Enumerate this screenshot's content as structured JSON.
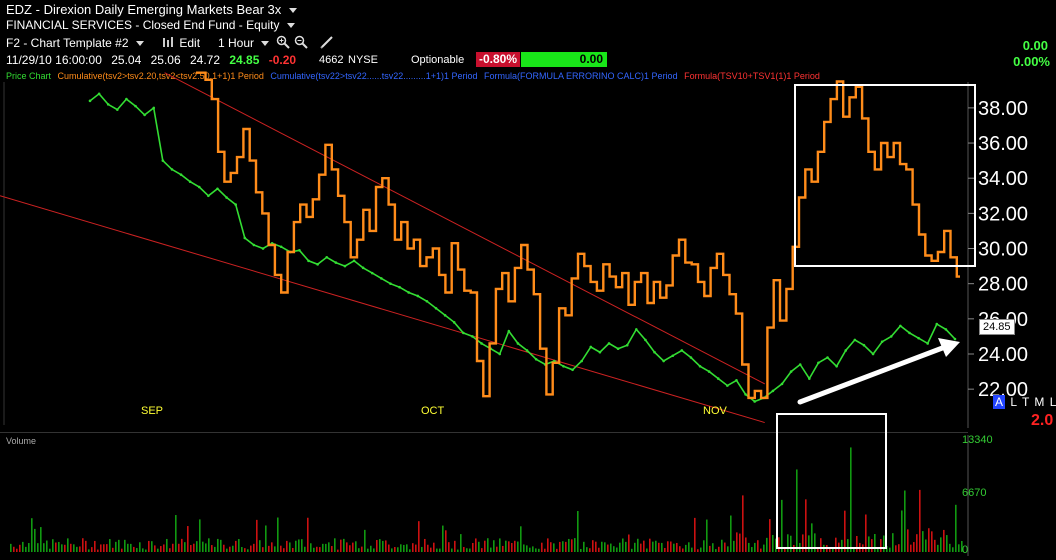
{
  "header": {
    "symbol": "EDZ",
    "dash": "-",
    "name": "Direxion Daily Emerging Markets Bear 3x",
    "sector": "FINANCIAL SERVICES - Closed End Fund - Equity",
    "template": "F2 - Chart Template #2",
    "edit_label": "Edit",
    "interval": "1 Hour",
    "datetime": "11/29/10 16:00:00",
    "open": "25.04",
    "high": "25.06",
    "low": "24.72",
    "last": "24.85",
    "change": "-0.20",
    "volume": "4662",
    "exchange": "NYSE",
    "optionable": "Optionable",
    "pct_change": "-0.80%",
    "green_box_value": "0.00",
    "right_top_value": "0.00",
    "right_top_pct": "0.00%"
  },
  "legend": {
    "price_chart": "Price Chart",
    "series1": "Cumulative(tsv2>tsv2.20,tsv2<tsv2.50,1+1)1 Period",
    "series2": "Cumulative(tsv22>tsv22......tsv22.........1+1)1 Period",
    "series3": "Formula(FORMULA ERRORINO CALC)1 Period",
    "series4": "Formula(TSV10+TSV1(1)1 Period"
  },
  "chart_data": {
    "type": "line",
    "y_ticks": [
      "38.00",
      "36.00",
      "34.00",
      "32.00",
      "30.00",
      "28.00",
      "26.00",
      "24.00",
      "22.00"
    ],
    "ylim": [
      20.7,
      39.7
    ],
    "x_months": [
      "SEP",
      "OCT",
      "NOV"
    ],
    "last_price_tag": "24.85",
    "indicator_value": "2.0",
    "series": [
      {
        "name": "Price",
        "color": "#33dd33",
        "y": [
          38.4,
          38.8,
          38.2,
          37.9,
          38.5,
          38.1,
          37.6,
          38.0,
          35.0,
          34.5,
          34.2,
          33.8,
          33.5,
          33.0,
          33.4,
          32.9,
          32.5,
          30.6,
          30.2,
          30.0,
          30.3,
          30.1,
          29.8,
          29.9,
          29.3,
          29.1,
          29.5,
          29.2,
          29.0,
          29.3,
          28.9,
          28.6,
          28.3,
          28.0,
          27.8,
          27.5,
          27.3,
          27.0,
          26.6,
          26.2,
          25.8,
          25.2,
          25.0,
          24.6,
          24.3,
          24.0,
          25.3,
          24.6,
          24.2,
          23.7,
          23.4,
          23.6,
          23.3,
          23.1,
          23.6,
          24.4,
          24.1,
          24.6,
          24.3,
          24.5,
          25.4,
          24.8,
          24.1,
          23.6,
          23.9,
          24.2,
          23.8,
          23.3,
          23.0,
          22.6,
          22.2,
          22.5,
          21.7,
          21.3,
          21.5,
          21.9,
          22.3,
          23.0,
          23.4,
          22.6,
          23.5,
          23.8,
          23.3,
          24.2,
          24.8,
          24.5,
          24.0,
          24.7,
          25.0,
          25.6,
          25.2,
          24.9,
          24.6,
          25.7,
          25.4,
          24.85
        ]
      },
      {
        "name": "Accumulation",
        "color": "#ff8c1a",
        "y": [
          40.0,
          40.0,
          39.6,
          38.5,
          35.5,
          33.8,
          34.3,
          35.2,
          36.8,
          35.0,
          33.2,
          32.0,
          30.2,
          28.5,
          27.5,
          29.8,
          31.5,
          32.5,
          31.8,
          32.8,
          34.2,
          35.9,
          34.5,
          33.0,
          31.5,
          29.5,
          30.5,
          32.2,
          31.0,
          33.5,
          34.0,
          32.5,
          30.5,
          31.5,
          30.0,
          30.5,
          29.0,
          29.5,
          30.0,
          28.5,
          27.5,
          30.3,
          28.8,
          27.6,
          27.5,
          23.6,
          21.6,
          24.6,
          27.7,
          28.6,
          27.0,
          28.9,
          30.2,
          28.8,
          27.4,
          24.3,
          21.7,
          23.5,
          26.6,
          26.2,
          28.3,
          29.7,
          29.0,
          28.1,
          27.6,
          29.1,
          28.4,
          27.8,
          28.6,
          26.8,
          28.1,
          28.6,
          26.9,
          28.1,
          27.2,
          27.9,
          29.6,
          30.5,
          29.2,
          29.1,
          28.1,
          27.3,
          28.9,
          29.7,
          28.5,
          27.4,
          26.3,
          23.4,
          21.5,
          21.9,
          21.5,
          25.5,
          28.2,
          25.9,
          27.7,
          30.1,
          32.9,
          34.5,
          33.8,
          35.5,
          37.2,
          38.5,
          39.5,
          37.5,
          38.6,
          39.2,
          37.4,
          35.5,
          34.5,
          36.0,
          35.2,
          36.0,
          34.8,
          34.5,
          32.5,
          30.8,
          29.6,
          29.3,
          29.8,
          31.0,
          29.5,
          28.4
        ]
      }
    ],
    "trendlines": [
      {
        "name": "upper",
        "color": "#cc2222",
        "x0": 0.17,
        "y0": 40.0,
        "x1": 0.79,
        "y1": 22.3
      },
      {
        "name": "lower",
        "color": "#cc2222",
        "x0": 0.0,
        "y0": 33.0,
        "x1": 0.79,
        "y1": 20.1
      }
    ]
  },
  "volume_panel": {
    "label": "Volume",
    "ticks": [
      "13340",
      "6670",
      "0"
    ],
    "ymax": 14500
  },
  "toolbar": {
    "zoom_in": "zoom-in-icon",
    "zoom_out": "zoom-out-icon",
    "draw": "pencil-icon"
  },
  "indicator_letters": {
    "a": "A",
    "l": "L",
    "t": "T",
    "m": "M",
    "l2": "L"
  }
}
